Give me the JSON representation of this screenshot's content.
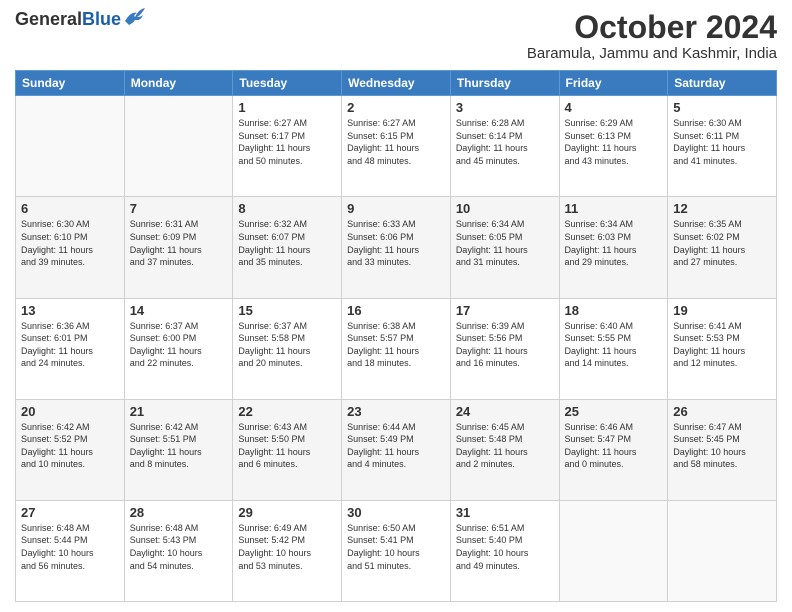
{
  "header": {
    "logo_general": "General",
    "logo_blue": "Blue",
    "title": "October 2024",
    "subtitle": "Baramula, Jammu and Kashmir, India"
  },
  "days_of_week": [
    "Sunday",
    "Monday",
    "Tuesday",
    "Wednesday",
    "Thursday",
    "Friday",
    "Saturday"
  ],
  "weeks": [
    [
      {
        "day": "",
        "info": ""
      },
      {
        "day": "",
        "info": ""
      },
      {
        "day": "1",
        "info": "Sunrise: 6:27 AM\nSunset: 6:17 PM\nDaylight: 11 hours\nand 50 minutes."
      },
      {
        "day": "2",
        "info": "Sunrise: 6:27 AM\nSunset: 6:15 PM\nDaylight: 11 hours\nand 48 minutes."
      },
      {
        "day": "3",
        "info": "Sunrise: 6:28 AM\nSunset: 6:14 PM\nDaylight: 11 hours\nand 45 minutes."
      },
      {
        "day": "4",
        "info": "Sunrise: 6:29 AM\nSunset: 6:13 PM\nDaylight: 11 hours\nand 43 minutes."
      },
      {
        "day": "5",
        "info": "Sunrise: 6:30 AM\nSunset: 6:11 PM\nDaylight: 11 hours\nand 41 minutes."
      }
    ],
    [
      {
        "day": "6",
        "info": "Sunrise: 6:30 AM\nSunset: 6:10 PM\nDaylight: 11 hours\nand 39 minutes."
      },
      {
        "day": "7",
        "info": "Sunrise: 6:31 AM\nSunset: 6:09 PM\nDaylight: 11 hours\nand 37 minutes."
      },
      {
        "day": "8",
        "info": "Sunrise: 6:32 AM\nSunset: 6:07 PM\nDaylight: 11 hours\nand 35 minutes."
      },
      {
        "day": "9",
        "info": "Sunrise: 6:33 AM\nSunset: 6:06 PM\nDaylight: 11 hours\nand 33 minutes."
      },
      {
        "day": "10",
        "info": "Sunrise: 6:34 AM\nSunset: 6:05 PM\nDaylight: 11 hours\nand 31 minutes."
      },
      {
        "day": "11",
        "info": "Sunrise: 6:34 AM\nSunset: 6:03 PM\nDaylight: 11 hours\nand 29 minutes."
      },
      {
        "day": "12",
        "info": "Sunrise: 6:35 AM\nSunset: 6:02 PM\nDaylight: 11 hours\nand 27 minutes."
      }
    ],
    [
      {
        "day": "13",
        "info": "Sunrise: 6:36 AM\nSunset: 6:01 PM\nDaylight: 11 hours\nand 24 minutes."
      },
      {
        "day": "14",
        "info": "Sunrise: 6:37 AM\nSunset: 6:00 PM\nDaylight: 11 hours\nand 22 minutes."
      },
      {
        "day": "15",
        "info": "Sunrise: 6:37 AM\nSunset: 5:58 PM\nDaylight: 11 hours\nand 20 minutes."
      },
      {
        "day": "16",
        "info": "Sunrise: 6:38 AM\nSunset: 5:57 PM\nDaylight: 11 hours\nand 18 minutes."
      },
      {
        "day": "17",
        "info": "Sunrise: 6:39 AM\nSunset: 5:56 PM\nDaylight: 11 hours\nand 16 minutes."
      },
      {
        "day": "18",
        "info": "Sunrise: 6:40 AM\nSunset: 5:55 PM\nDaylight: 11 hours\nand 14 minutes."
      },
      {
        "day": "19",
        "info": "Sunrise: 6:41 AM\nSunset: 5:53 PM\nDaylight: 11 hours\nand 12 minutes."
      }
    ],
    [
      {
        "day": "20",
        "info": "Sunrise: 6:42 AM\nSunset: 5:52 PM\nDaylight: 11 hours\nand 10 minutes."
      },
      {
        "day": "21",
        "info": "Sunrise: 6:42 AM\nSunset: 5:51 PM\nDaylight: 11 hours\nand 8 minutes."
      },
      {
        "day": "22",
        "info": "Sunrise: 6:43 AM\nSunset: 5:50 PM\nDaylight: 11 hours\nand 6 minutes."
      },
      {
        "day": "23",
        "info": "Sunrise: 6:44 AM\nSunset: 5:49 PM\nDaylight: 11 hours\nand 4 minutes."
      },
      {
        "day": "24",
        "info": "Sunrise: 6:45 AM\nSunset: 5:48 PM\nDaylight: 11 hours\nand 2 minutes."
      },
      {
        "day": "25",
        "info": "Sunrise: 6:46 AM\nSunset: 5:47 PM\nDaylight: 11 hours\nand 0 minutes."
      },
      {
        "day": "26",
        "info": "Sunrise: 6:47 AM\nSunset: 5:45 PM\nDaylight: 10 hours\nand 58 minutes."
      }
    ],
    [
      {
        "day": "27",
        "info": "Sunrise: 6:48 AM\nSunset: 5:44 PM\nDaylight: 10 hours\nand 56 minutes."
      },
      {
        "day": "28",
        "info": "Sunrise: 6:48 AM\nSunset: 5:43 PM\nDaylight: 10 hours\nand 54 minutes."
      },
      {
        "day": "29",
        "info": "Sunrise: 6:49 AM\nSunset: 5:42 PM\nDaylight: 10 hours\nand 53 minutes."
      },
      {
        "day": "30",
        "info": "Sunrise: 6:50 AM\nSunset: 5:41 PM\nDaylight: 10 hours\nand 51 minutes."
      },
      {
        "day": "31",
        "info": "Sunrise: 6:51 AM\nSunset: 5:40 PM\nDaylight: 10 hours\nand 49 minutes."
      },
      {
        "day": "",
        "info": ""
      },
      {
        "day": "",
        "info": ""
      }
    ]
  ]
}
